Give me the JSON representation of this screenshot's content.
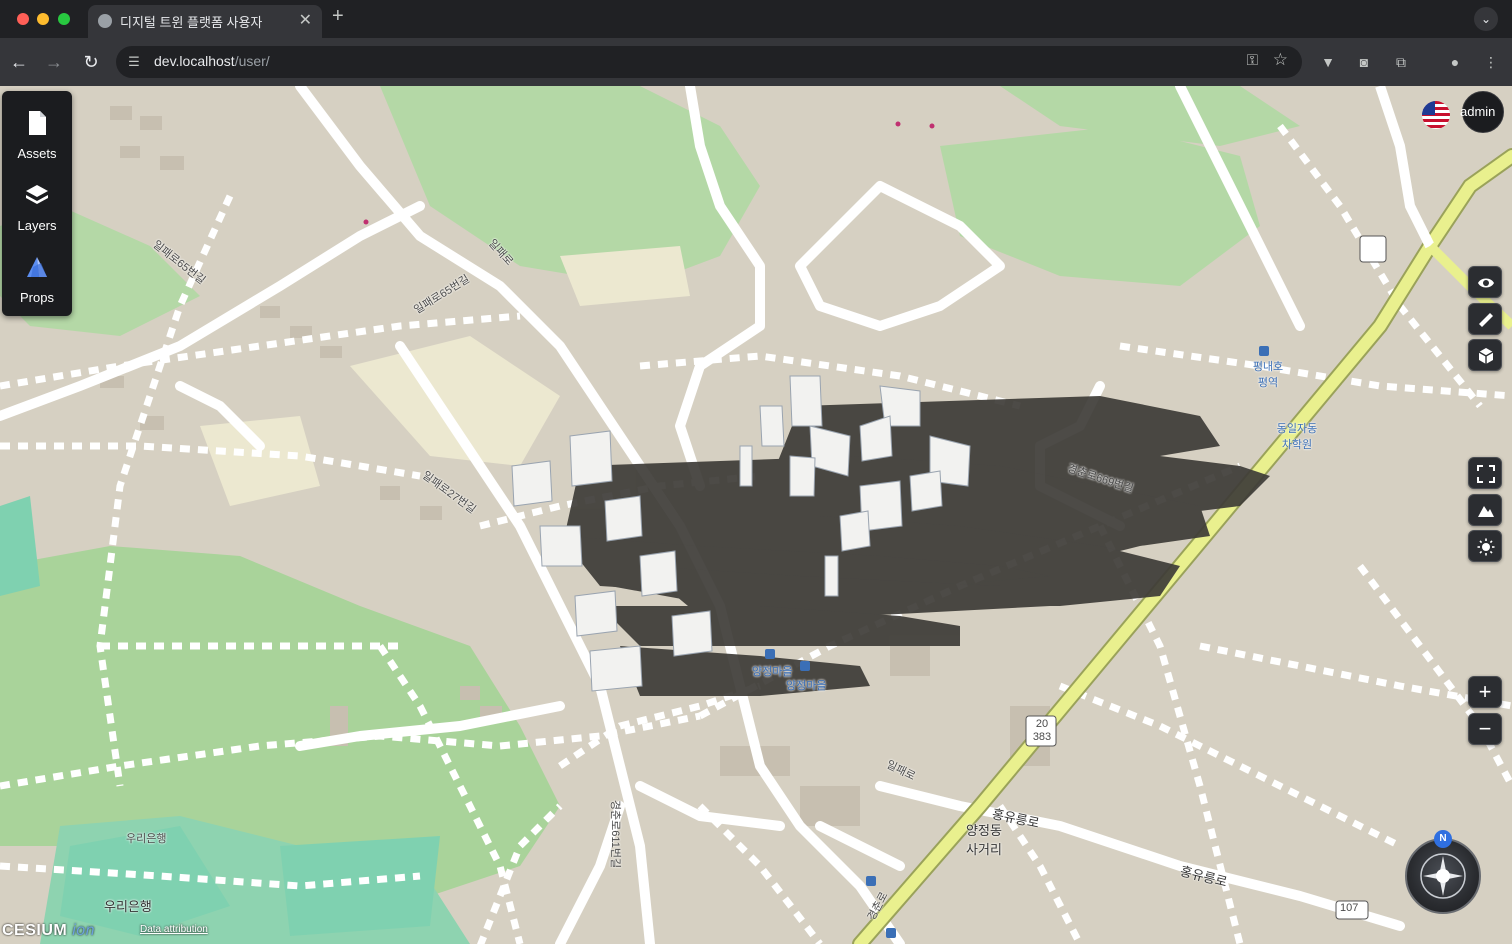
{
  "browser": {
    "tab_title": "디지털 트윈 플랫폼 사용자",
    "tab_close": "✕",
    "new_tab": "+",
    "tab_menu": "⌄",
    "url_host": "dev.localhost",
    "url_path": "/user/"
  },
  "toolbox": {
    "items": [
      {
        "label": "Assets",
        "icon": "document-icon"
      },
      {
        "label": "Layers",
        "icon": "layers-icon"
      },
      {
        "label": "Props",
        "icon": "props-icon"
      }
    ]
  },
  "user": {
    "name": "admin",
    "flag_icon": "us-flag-icon"
  },
  "controls": {
    "zoom_in": "+",
    "zoom_out": "−",
    "compass_north": "N"
  },
  "footer": {
    "logo_text": "CESIUM",
    "logo_suffix": "ion",
    "attribution": "Data attribution"
  },
  "map_labels": [
    "일패로65번길",
    "일패로65번길",
    "일패로",
    "일패로27번길",
    "경춘로669번길",
    "경춘로611번길",
    "경춘로",
    "양정마을",
    "양정마을",
    "일패로",
    "양정동 사거리",
    "홍유릉로",
    "홍유릉로",
    "우리은행",
    "우리은행",
    "20 383",
    "107",
    "동일자동차학원",
    "평내호평역"
  ],
  "colors": {
    "panel_bg": "#1b1c1f",
    "map_bg": "#d8d2c4",
    "park_green": "#a8d29a",
    "highway_yellow": "#e8f08a",
    "shadow": "#3c3a36"
  }
}
